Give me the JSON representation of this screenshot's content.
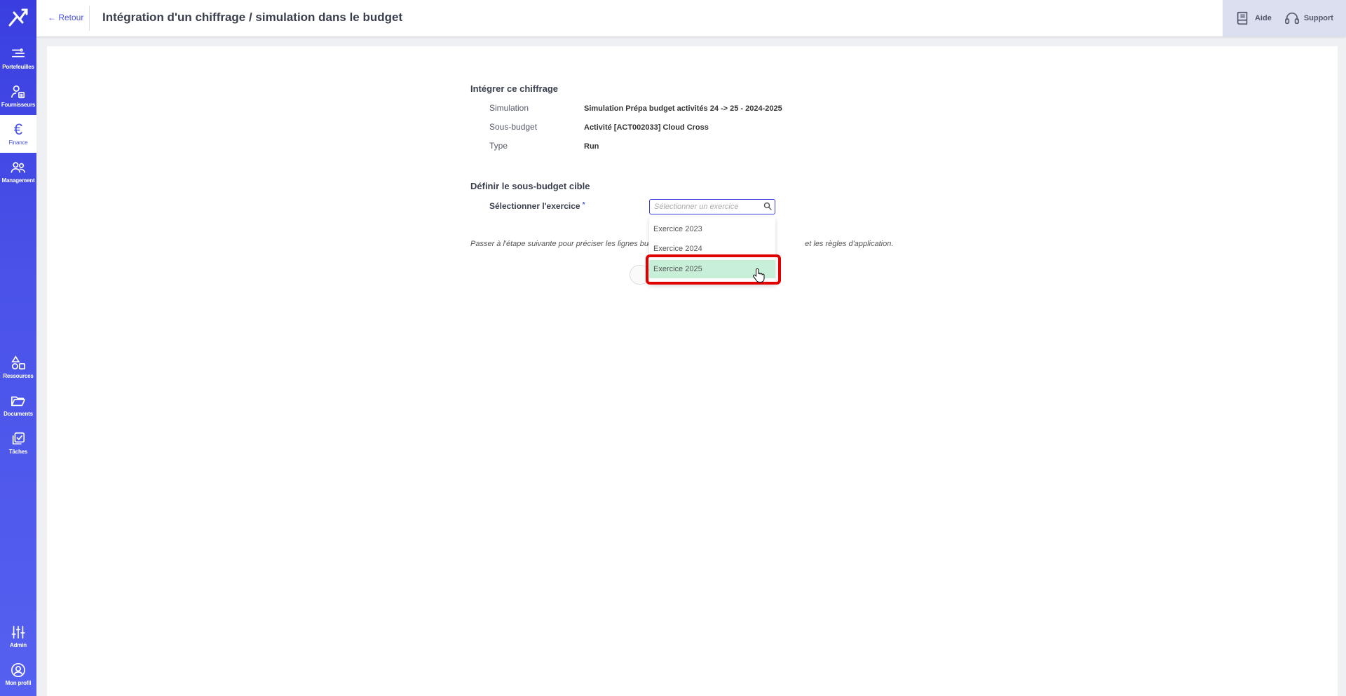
{
  "sidebar": {
    "items": [
      {
        "label": "Portefeuilles",
        "icon": "portfolio-icon"
      },
      {
        "label": "Fournisseurs",
        "icon": "suppliers-icon"
      },
      {
        "label": "Finance",
        "icon": "euro-icon",
        "glyph": "€"
      },
      {
        "label": "Management",
        "icon": "management-icon"
      },
      {
        "label": "Ressources",
        "icon": "resources-icon"
      },
      {
        "label": "Documents",
        "icon": "folder-icon"
      },
      {
        "label": "Tâches",
        "icon": "tasks-icon"
      },
      {
        "label": "Admin",
        "icon": "sliders-icon"
      },
      {
        "label": "Mon profil",
        "icon": "profile-icon"
      }
    ]
  },
  "topbar": {
    "back_label": "← Retour",
    "title": "Intégration d'un chiffrage / simulation dans le budget",
    "help_label": "Aide",
    "support_label": "Support"
  },
  "integrate": {
    "title": "Intégrer ce chiffrage",
    "simulation_label": "Simulation",
    "simulation_value": "Simulation Prépa budget activités 24 -> 25 - 2024-2025",
    "subbudget_label": "Sous-budget",
    "subbudget_value": "Activité [ACT002033] Cloud Cross",
    "type_label": "Type",
    "type_value": "Run"
  },
  "target": {
    "title": "Définir le sous-budget cible",
    "exercise_label": "Sélectionner l'exercice",
    "required_mark": "*",
    "placeholder": "Sélectionner un exercice"
  },
  "hint": {
    "before": "Passer à l'étape suivante pour préciser les lignes bud",
    "after": "et les règles d'application."
  },
  "dropdown": {
    "options": [
      "Exercice 2023",
      "Exercice 2024",
      "Exercice 2025"
    ],
    "highlighted": "Exercice 2025"
  },
  "colors": {
    "accent": "#3a3ee0",
    "highlight_option": "#c8f0d8",
    "annotation": "#e00000"
  }
}
